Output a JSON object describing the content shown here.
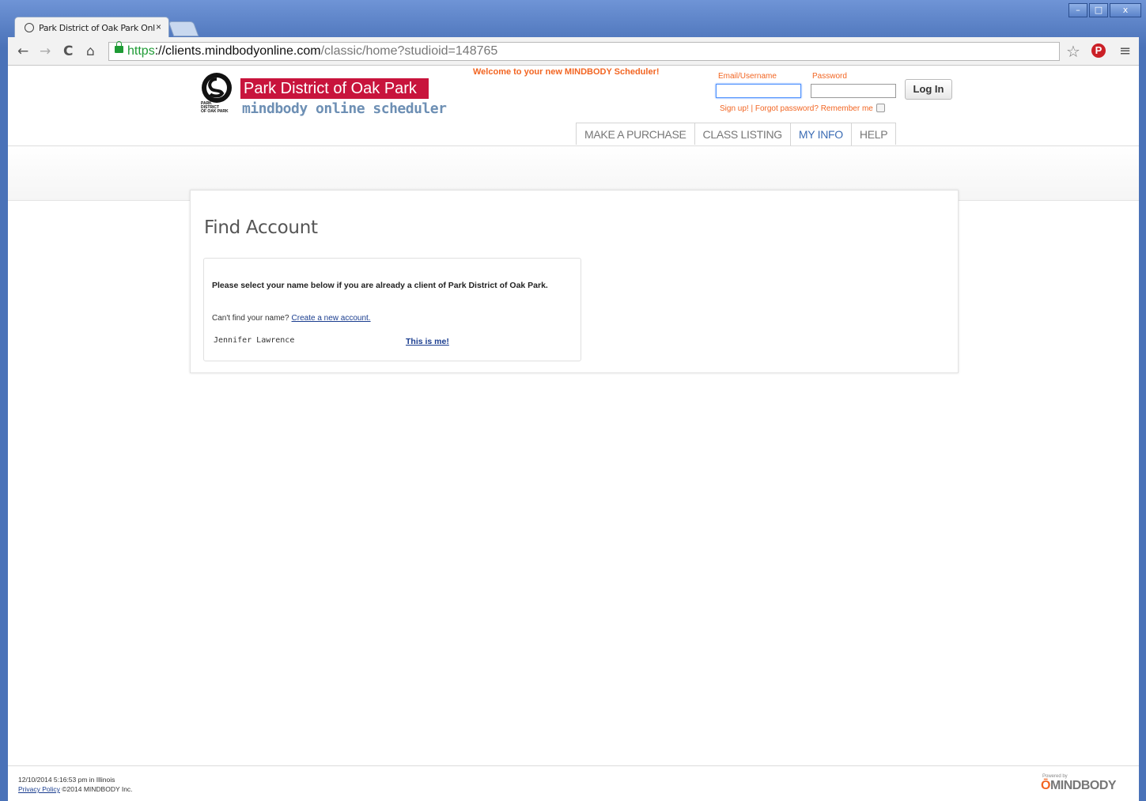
{
  "browser": {
    "tab_title": "Park District of Oak Park Onl",
    "tab_close": "×",
    "url_scheme": "https",
    "url_host": "://clients.mindbodyonline.com",
    "url_path": "/classic/home?studioid=148765",
    "window_controls": [
      "–",
      "□",
      "x"
    ],
    "icons": [
      "back-arrow-icon",
      "forward-arrow-icon",
      "reload-icon",
      "home-icon",
      "lock-icon",
      "star-icon",
      "pinterest-icon",
      "menu-icon"
    ]
  },
  "header": {
    "brand_name": "Park District of Oak Park",
    "brand_subtitle": "mindbody online scheduler",
    "welcome": "Welcome to your new MINDBODY Scheduler!",
    "email_label": "Email/Username",
    "password_label": "Password",
    "login_button": "Log In",
    "signup_link": "Sign up!",
    "separator": "|",
    "forgot_link": "Forgot password?",
    "remember_label": "Remember me"
  },
  "nav": {
    "tabs": [
      {
        "label": "MAKE A PURCHASE"
      },
      {
        "label": "CLASS LISTING"
      },
      {
        "label": "MY INFO",
        "active": true
      },
      {
        "label": "HELP"
      }
    ]
  },
  "main": {
    "title": "Find Account",
    "instruction": "Please select your name below if you are already a client of Park District of Oak Park.",
    "cant_find": "Can't find your name?",
    "create_link": "Create a new account.",
    "client_name": "Jennifer Lawrence",
    "select_link": "This is me!"
  },
  "footer": {
    "timestamp": "12/10/2014 5:16:53 pm in Illinois",
    "privacy_link": "Privacy Policy",
    "copyright": "©2014 MINDBODY Inc.",
    "powered_by": "Powered by",
    "logo_text": "MINDBODY"
  },
  "colors": {
    "brand_red": "#c8143c",
    "accent_orange": "#f26522",
    "link_blue": "#1a3d8f",
    "active_tab_blue": "#3b6cb4"
  }
}
